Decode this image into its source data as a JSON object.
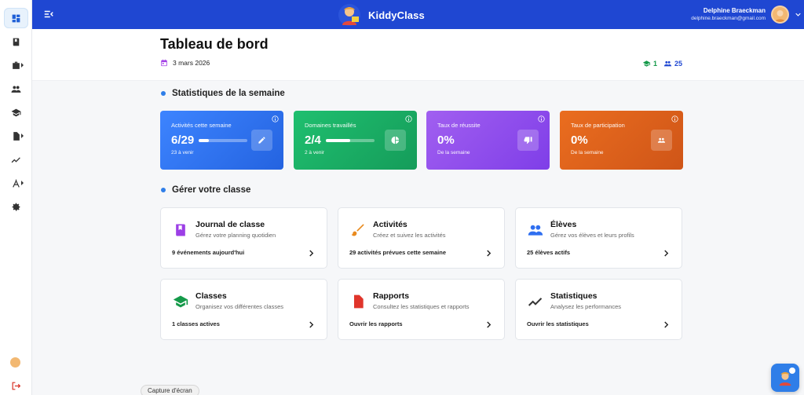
{
  "app": {
    "name": "KiddyClass"
  },
  "user": {
    "name": "Delphine Braeckman",
    "email": "delphine.braeckman@gmail.com"
  },
  "sidebar": {
    "items": [
      {
        "icon": "dashboard-icon",
        "active": true
      },
      {
        "icon": "book-icon"
      },
      {
        "icon": "briefcase-icon",
        "has_submenu": true
      },
      {
        "icon": "people-icon"
      },
      {
        "icon": "graduation-cap-icon"
      },
      {
        "icon": "document-icon",
        "has_submenu": true
      },
      {
        "icon": "trending-icon"
      },
      {
        "icon": "compass-icon",
        "has_submenu": true
      },
      {
        "icon": "gear-icon"
      }
    ]
  },
  "page": {
    "title": "Tableau de bord",
    "date": "3 mars 2026",
    "class_count": "1",
    "student_count": "25"
  },
  "stats_section": {
    "title": "Statistiques de la semaine",
    "cards": [
      {
        "label": "Activités cette semaine",
        "value": "6/29",
        "progress": 0.21,
        "sub": "23 à venir",
        "icon": "pencil-icon",
        "color": "#2f6ff0"
      },
      {
        "label": "Domaines travaillés",
        "value": "2/4",
        "progress": 0.5,
        "sub": "2 à venir",
        "icon": "pie-chart-icon",
        "color": "#1aae62"
      },
      {
        "label": "Taux de réussite",
        "value": "0%",
        "sub": "De la semaine",
        "icon": "thumb-down-icon",
        "color": "#9050ec"
      },
      {
        "label": "Taux de participation",
        "value": "0%",
        "sub": "De la semaine",
        "icon": "people-icon",
        "color": "#de6119"
      }
    ]
  },
  "manage_section": {
    "title": "Gérer votre classe",
    "cards": [
      {
        "title": "Journal de classe",
        "desc": "Gérez votre planning quotidien",
        "footer": "9 événements aujourd'hui",
        "icon": "book-icon",
        "color": "#9c3fe6"
      },
      {
        "title": "Activités",
        "desc": "Créez et suivez les activités",
        "footer": "29 activités prévues cette semaine",
        "icon": "paintbrush-icon",
        "color": "#e98a1e"
      },
      {
        "title": "Élèves",
        "desc": "Gérez vos élèves et leurs profils",
        "footer": "25 élèves actifs",
        "icon": "people-icon",
        "color": "#2f6ff0"
      },
      {
        "title": "Classes",
        "desc": "Organisez vos différentes classes",
        "footer": "1 classes actives",
        "icon": "graduation-cap-icon",
        "color": "#159a4a"
      },
      {
        "title": "Rapports",
        "desc": "Consultez les statistiques et rapports",
        "footer": "Ouvrir les rapports",
        "icon": "report-icon",
        "color": "#e0352b"
      },
      {
        "title": "Statistiques",
        "desc": "Analysez les performances",
        "footer": "Ouvrir les statistiques",
        "icon": "trending-icon",
        "color": "#333333"
      }
    ]
  },
  "tooltip": "Capture d'écran"
}
